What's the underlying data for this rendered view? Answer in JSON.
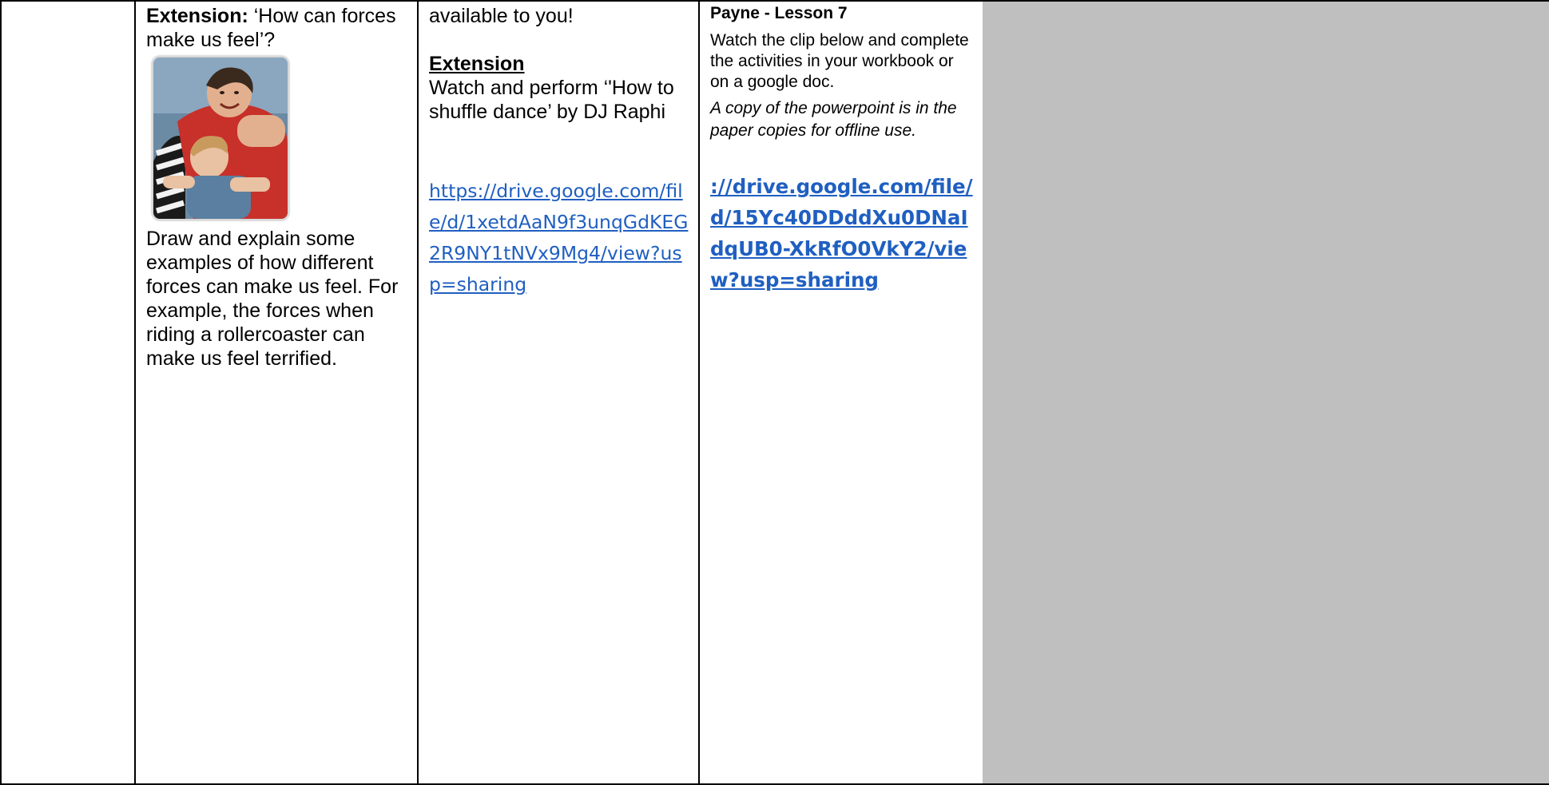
{
  "col2": {
    "extension_label": "Extension:",
    "extension_question": " ‘How can forces make us feel’?",
    "photo_icon": "rollercoaster-photo",
    "description": "Draw and explain some examples of how different forces can make us feel. For example, the forces when riding a rollercoaster can make us feel terrified."
  },
  "col3": {
    "top_text": "available to you!",
    "extension_heading": "Extension",
    "instruction": "Watch and perform ‘'How to shuffle dance’ by DJ Raphi",
    "link": "https://drive.google.com/file/d/1xetdAaN9f3unqGdKEG2R9NY1tNVx9Mg4/view?usp=sharing"
  },
  "col4": {
    "title": "Payne - Lesson 7",
    "body": "Watch the clip below and complete the activities in your workbook or on a google doc.",
    "italic_note": "A copy of the powerpoint is in the paper copies for offline use.",
    "link": "://drive.google.com/file/d/15Yc40DDddXu0DNaIdqUB0-XkRfO0VkY2/view?usp=sharing"
  },
  "colors": {
    "shaded_cell": "#bfbfbf",
    "link": "#1f5fc1"
  }
}
